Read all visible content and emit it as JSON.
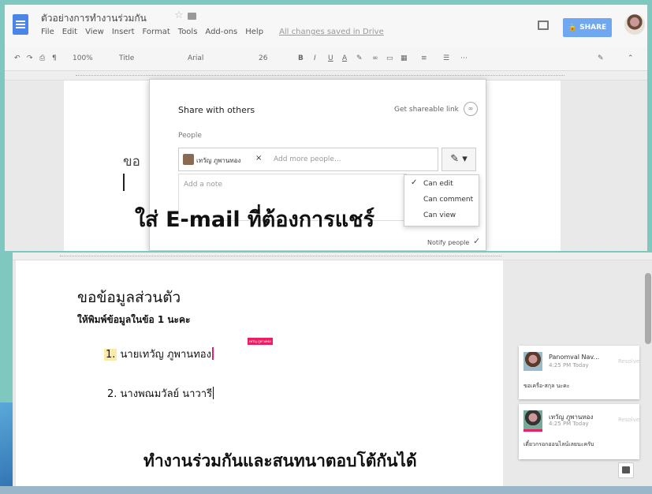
{
  "top_window": {
    "doc_title": "ตัวอย่างการทำงานร่วมกัน",
    "menu": [
      "File",
      "Edit",
      "View",
      "Insert",
      "Format",
      "Tools",
      "Add-ons",
      "Help"
    ],
    "saved_status": "All changes saved in Drive",
    "share_label": "SHARE",
    "toolbar": {
      "zoom": "100%",
      "style": "Title",
      "font": "Arial",
      "size": "26"
    },
    "page_char": "ขอ"
  },
  "share_dialog": {
    "title": "Share with others",
    "shareable_link": "Get shareable link",
    "people_label": "People",
    "chip_name": "เทวัญ ภูพานทอง",
    "chip_close": "×",
    "add_people_placeholder": "Add more people...",
    "note_placeholder": "Add a note",
    "permissions": [
      "Can edit",
      "Can comment",
      "Can view"
    ],
    "selected_permission": "Can edit",
    "notify_label": "Notify people"
  },
  "caption_email": "ใส่ E-mail ที่ต้องการแชร์",
  "document": {
    "heading": "ขอข้อมูลส่วนตัว",
    "subheading": "ให้พิมพ์ข้อมูลในข้อ 1 นะคะ",
    "line1_num": "1.",
    "line1_text": " นายเทวัญ  ภูพานทอง",
    "collaborator_tag": "เทวัญ ภูพานทอง",
    "line2": "2. นางพณมวัลย์ นาวารี"
  },
  "comments": [
    {
      "author": "Panomval Nav...",
      "time": "4:25 PM Today",
      "resolve": "Resolve",
      "text": "ขอเครื่อ-สกุล นะคะ"
    },
    {
      "author": "เทวัญ ภูพานทอง",
      "time": "4:25 PM Today",
      "resolve": "Resolve",
      "text": "เดี๋ยวกรอกออนไลน์เลยนะครับ"
    }
  ],
  "caption_collab": "ทำงานร่วมกันและสนทนาตอบโต้กันได้",
  "colors": {
    "share_button": "#6fa8f0",
    "collaborator": "#e91e63",
    "background": "#7ec8c0"
  }
}
